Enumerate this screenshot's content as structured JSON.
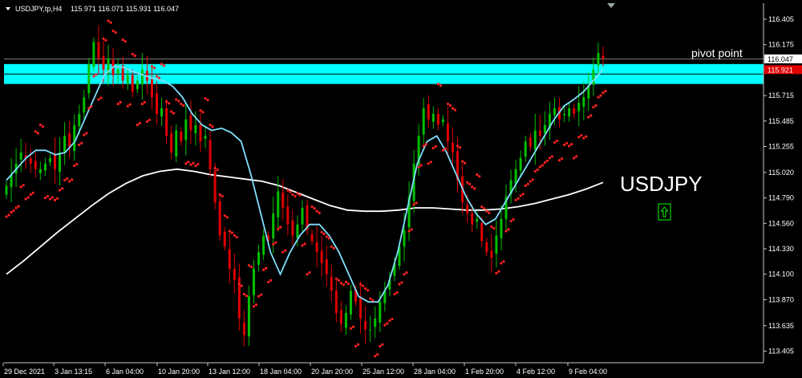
{
  "header": {
    "symbol_timeframe": "USDJPY,tp,H4",
    "ohlc": "115.971 116.071 115.931 116.047"
  },
  "annotations": {
    "pivot_label": "pivot point",
    "symbol_label": "USDJPY",
    "price_tag_current": "116.047",
    "price_tag_zone": "115.921"
  },
  "colors": {
    "background": "#000000",
    "bull": "#00c000",
    "bear": "#e00000",
    "fast_ma": "#7fdfff",
    "slow_ma": "#ffffff",
    "sar": "#ff2020",
    "zone": "#00ffff",
    "arrow": "#00ff00"
  },
  "chart_data": {
    "type": "candlestick",
    "title": "USDJPY",
    "ylim": [
      113.3,
      116.55
    ],
    "y_ticks": [
      "116.405",
      "116.175",
      "115.945",
      "115.715",
      "115.485",
      "115.255",
      "115.020",
      "114.790",
      "114.560",
      "114.330",
      "114.100",
      "113.870",
      "113.635",
      "113.405"
    ],
    "x_ticks": [
      "29 Dec 2021",
      "3 Jan 13:15",
      "6 Jan 04:00",
      "10 Jan 20:00",
      "13 Jan 12:00",
      "18 Jan 04:00",
      "20 Jan 20:00",
      "25 Jan 12:00",
      "28 Jan 04:00",
      "1 Feb 20:00",
      "4 Feb 12:00",
      "9 Feb 04:00"
    ],
    "zone": {
      "low": 115.82,
      "high": 116.0
    },
    "pivot_level": 116.047,
    "series": [
      {
        "name": "close",
        "values": [
          114.9,
          115.0,
          115.1,
          115.2,
          115.15,
          115.1,
          115.05,
          115.05,
          115.1,
          115.15,
          115.05,
          115.2,
          115.35,
          115.25,
          115.45,
          115.55,
          115.7,
          116.0,
          116.2,
          116.05,
          115.95,
          116.05,
          115.9,
          115.95,
          115.85,
          115.9,
          115.75,
          115.85,
          115.95,
          115.85,
          115.7,
          115.55,
          115.6,
          115.35,
          115.2,
          115.4,
          115.3,
          115.5,
          115.4,
          115.45,
          115.3,
          115.35,
          115.05,
          114.75,
          114.45,
          114.35,
          114.15,
          114.05,
          113.7,
          113.55,
          113.9,
          114.15,
          114.3,
          114.45,
          114.4,
          114.65,
          114.85,
          114.7,
          114.55,
          114.45,
          114.55,
          114.7,
          114.5,
          114.4,
          114.3,
          114.2,
          114.1,
          113.95,
          113.75,
          113.65,
          113.75,
          113.95,
          113.85,
          113.7,
          113.6,
          113.6,
          113.7,
          113.85,
          113.95,
          114.05,
          114.2,
          114.35,
          114.5,
          114.8,
          115.1,
          115.35,
          115.6,
          115.5,
          115.55,
          115.45,
          115.5,
          115.3,
          115.2,
          114.95,
          114.75,
          114.65,
          114.55,
          114.6,
          114.4,
          114.3,
          114.25,
          114.45,
          114.6,
          114.8,
          114.95,
          115.05,
          115.15,
          115.3,
          115.25,
          115.4,
          115.35,
          115.45,
          115.55,
          115.6,
          115.5,
          115.55,
          115.6,
          115.55,
          115.65,
          115.7,
          115.8,
          115.95,
          116.1,
          116.05
        ]
      },
      {
        "name": "fast_ma",
        "values": [
          114.95,
          115.05,
          115.15,
          115.22,
          115.22,
          115.18,
          115.2,
          115.3,
          115.5,
          115.7,
          115.9,
          115.98,
          115.97,
          115.93,
          115.9,
          115.87,
          115.85,
          115.8,
          115.7,
          115.55,
          115.45,
          115.4,
          115.42,
          115.38,
          115.3,
          115.0,
          114.65,
          114.3,
          114.1,
          114.3,
          114.45,
          114.55,
          114.55,
          114.45,
          114.3,
          114.1,
          113.9,
          113.85,
          113.85,
          114.0,
          114.3,
          114.7,
          115.1,
          115.3,
          115.35,
          115.2,
          115.0,
          114.8,
          114.65,
          114.55,
          114.6,
          114.75,
          114.9,
          115.05,
          115.2,
          115.35,
          115.5,
          115.62,
          115.68,
          115.75,
          115.85,
          115.95
        ]
      },
      {
        "name": "slow_ma",
        "values": [
          114.1,
          114.22,
          114.35,
          114.48,
          114.6,
          114.72,
          114.83,
          114.92,
          114.99,
          115.03,
          115.05,
          115.03,
          115.0,
          114.98,
          114.96,
          114.94,
          114.9,
          114.84,
          114.78,
          114.72,
          114.68,
          114.67,
          114.67,
          114.68,
          114.7,
          114.7,
          114.69,
          114.68,
          114.68,
          114.69,
          114.71,
          114.74,
          114.78,
          114.82,
          114.87,
          114.93
        ]
      }
    ]
  }
}
